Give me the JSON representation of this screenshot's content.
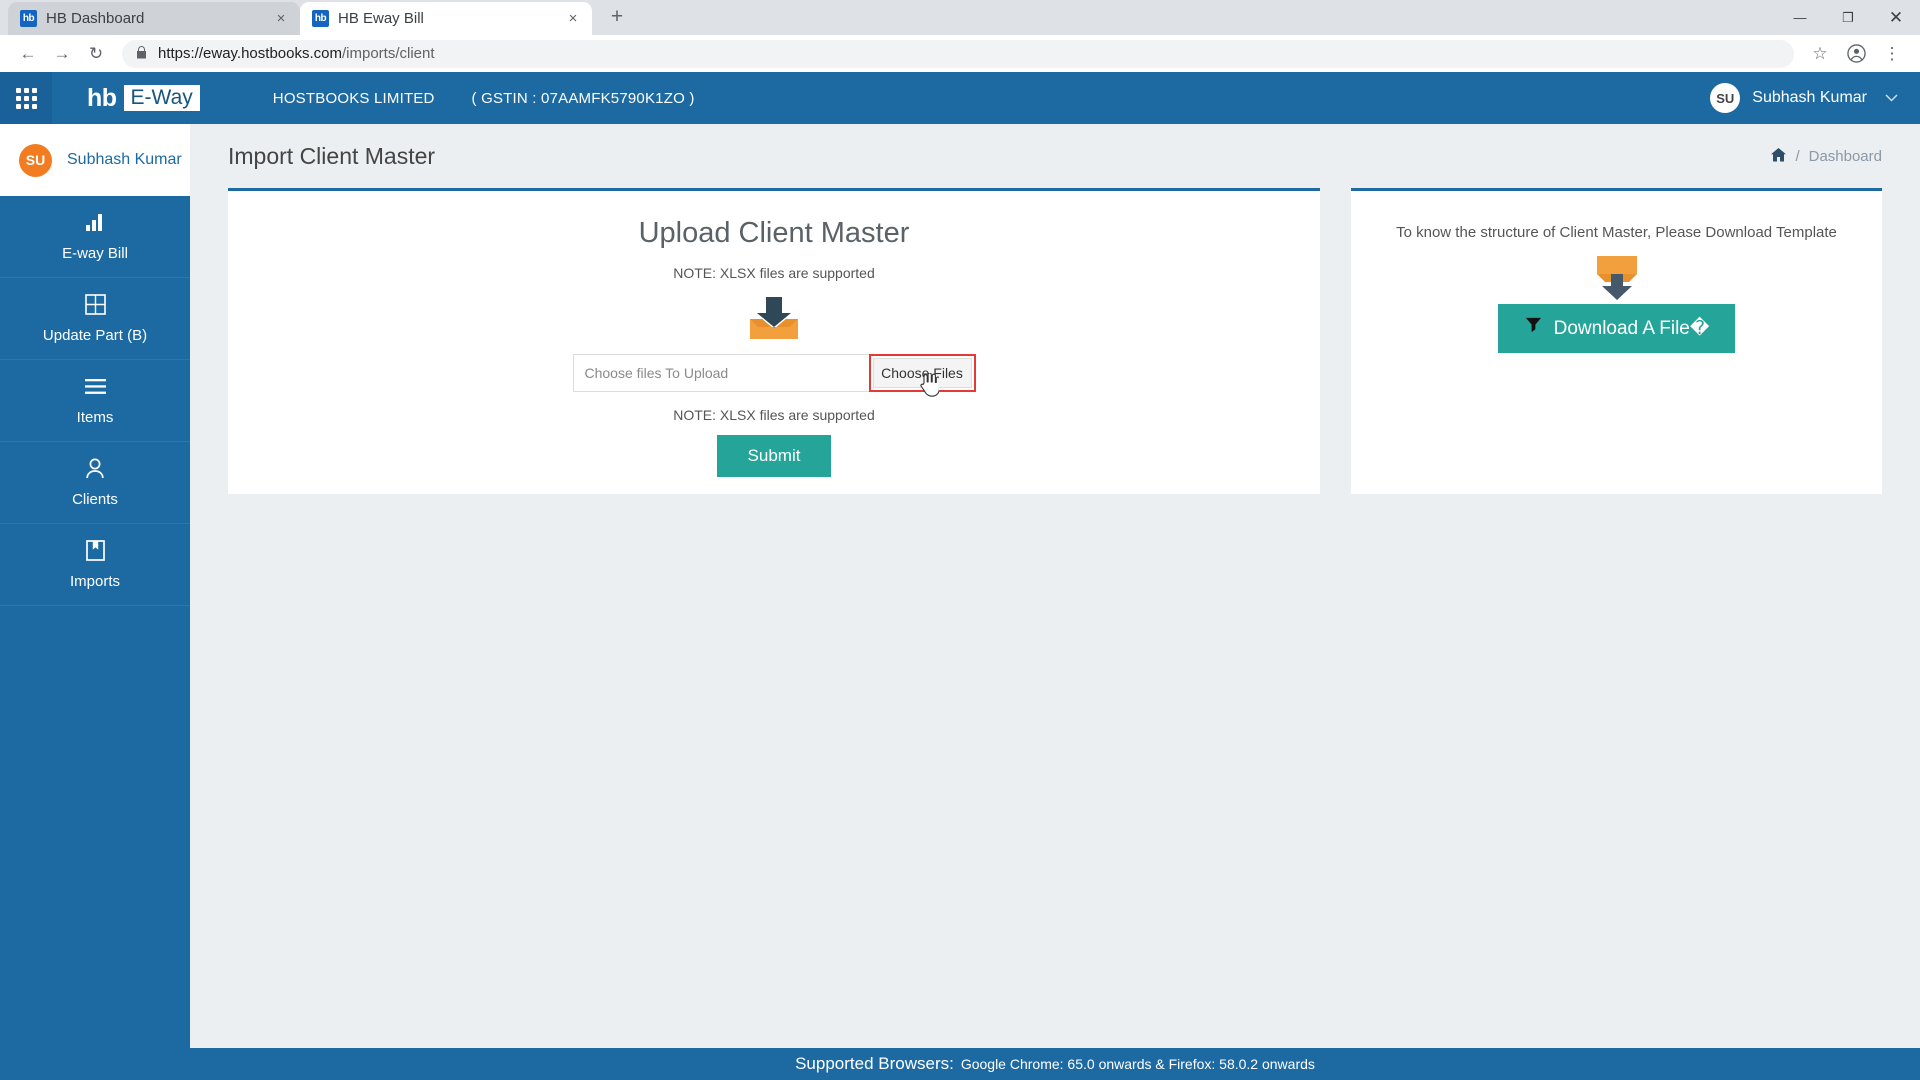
{
  "browser": {
    "tabs": [
      {
        "title": "HB Dashboard",
        "favicon": "hb",
        "active": false
      },
      {
        "title": "HB Eway Bill",
        "favicon": "hb",
        "active": true
      }
    ],
    "new_tab_label": "+",
    "close_label": "×",
    "window_controls": {
      "minimize": "—",
      "maximize": "❐",
      "close": "✕"
    },
    "nav": {
      "back": "←",
      "forward": "→",
      "reload": "↻"
    },
    "address": {
      "lock_icon": "🔒",
      "url_domain": "https://eway.hostbooks.com",
      "url_path": "/imports/client",
      "full_url": "https://eway.hostbooks.com/imports/client"
    },
    "toolbar_right": {
      "bookmark": "☆",
      "profile": "profile-icon",
      "menu": "⋮"
    }
  },
  "topbar": {
    "apps_icon": "grid-apps-icon",
    "logo_hb": "hb",
    "logo_eway": "E-Way",
    "company": "HOSTBOOKS LIMITED",
    "gstin": "( GSTIN : 07AAMFK5790K1ZO )",
    "user": {
      "initials": "SU",
      "name": "Subhash Kumar",
      "caret": "⌄"
    }
  },
  "sidebar": {
    "user": {
      "initials": "SU",
      "name": "Subhash Kumar"
    },
    "items": [
      {
        "label": "E-way Bill",
        "icon": "bar-chart-icon"
      },
      {
        "label": "Update Part (B)",
        "icon": "grid-table-icon"
      },
      {
        "label": "Items",
        "icon": "menu-lines-icon"
      },
      {
        "label": "Clients",
        "icon": "user-icon"
      },
      {
        "label": "Imports",
        "icon": "bookmark-book-icon"
      }
    ]
  },
  "page": {
    "title": "Import Client Master",
    "breadcrumb": {
      "home_icon": "home-icon",
      "separator": "/",
      "current": "Dashboard"
    }
  },
  "upload_card": {
    "title": "Upload Client Master",
    "note_top": "NOTE: XLSX files are supported",
    "note_bottom": "NOTE: XLSX files are supported",
    "upload_icon": "upload-box-icon",
    "file_placeholder": "Choose files To Upload",
    "choose_button": "Choose Files",
    "submit_button": "Submit",
    "highlight_color": "#e53935",
    "accent_color": "#25a599"
  },
  "download_card": {
    "text": "To know the structure of Client Master, Please Download Template",
    "download_icon": "download-box-icon",
    "button_label": "Download A File�",
    "button_icon": "download-arrow-icon"
  },
  "footer": {
    "strong": "Supported Browsers:",
    "normal": "Google Chrome: 65.0 onwards & Firefox: 58.0.2 onwards"
  }
}
